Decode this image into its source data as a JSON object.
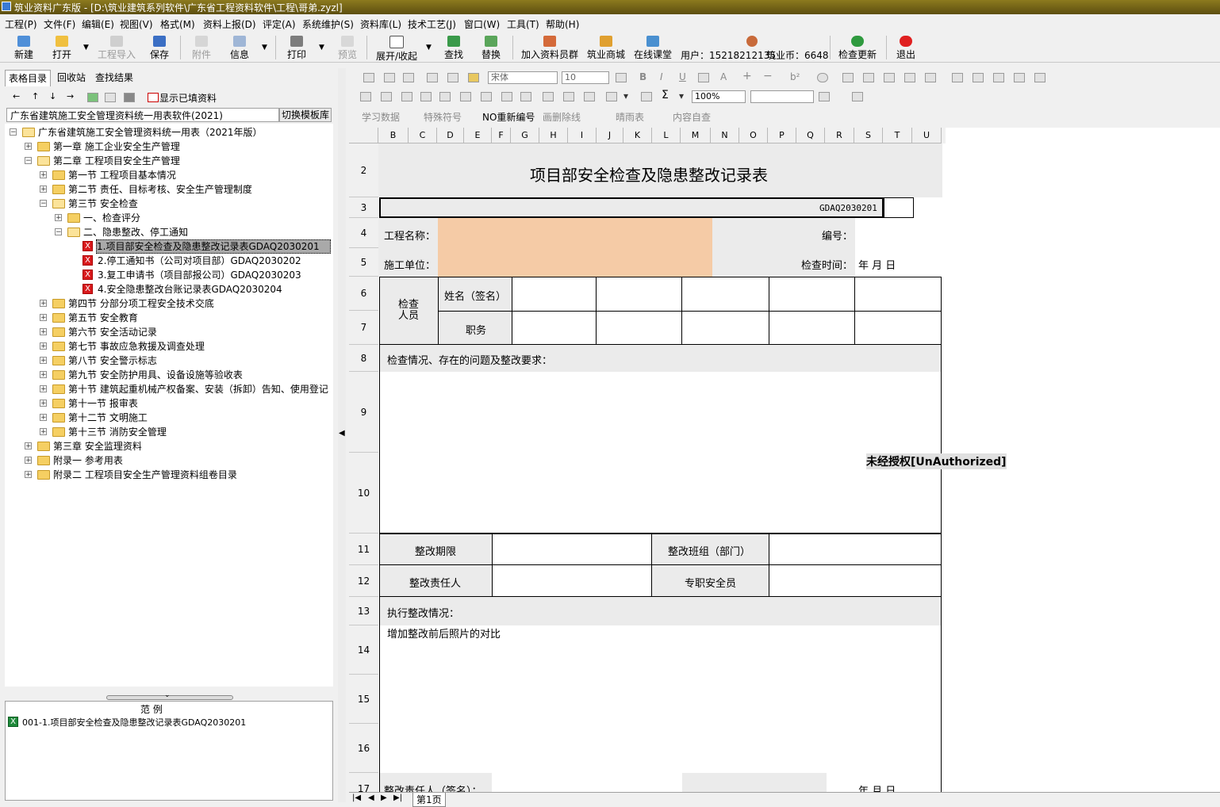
{
  "window": {
    "title": "筑业资料广东版 - [D:\\筑业建筑系列软件\\广东省工程资料软件\\工程\\哥弟.zyzl]"
  },
  "menu": [
    "工程(P)",
    "文件(F)",
    "编辑(E)",
    "视图(V)",
    "格式(M)",
    "资料上报(D)",
    "评定(A)",
    "系统维护(S)",
    "资料库(L)",
    "技术工艺(J)",
    "窗口(W)",
    "工具(T)",
    "帮助(H)"
  ],
  "toolbar": {
    "new": "新建",
    "open": "打开",
    "import": "工程导入",
    "save": "保存",
    "attach": "附件",
    "info": "信息",
    "print": "打印",
    "preview": "预览",
    "expand": "展开/收起",
    "find": "查找",
    "replace": "替换",
    "join": "加入资料员群",
    "shop": "筑业商城",
    "course": "在线课堂",
    "user": "用户：15218212135",
    "coins": "筑业币：6648",
    "update": "检查更新",
    "exit": "退出"
  },
  "left": {
    "tabs": [
      "表格目录",
      "回收站",
      "查找结果"
    ],
    "show_filled": "显示已填资料",
    "combo": "广东省建筑施工安全管理资料统一用表软件(2021)",
    "switch": "切换模板库",
    "tree": [
      "广东省建筑施工安全管理资料统一用表（2021年版）",
      "第一章 施工企业安全生产管理",
      "第二章 工程项目安全生产管理",
      "第一节 工程项目基本情况",
      "第二节 责任、目标考核、安全生产管理制度",
      "第三节 安全检查",
      "一、检查评分",
      "二、隐患整改、停工通知",
      "1.项目部安全检查及隐患整改记录表GDAQ2030201",
      "2.停工通知书（公司对项目部）GDAQ2030202",
      "3.复工申请书（项目部报公司）GDAQ2030203",
      "4.安全隐患整改台账记录表GDAQ2030204",
      "第四节 分部分项工程安全技术交底",
      "第五节 安全教育",
      "第六节 安全活动记录",
      "第七节 事故应急救援及调查处理",
      "第八节 安全警示标志",
      "第九节 安全防护用具、设备设施等验收表",
      "第十节 建筑起重机械产权备案、安装（拆卸）告知、使用登记",
      "第十一节 报审表",
      "第十二节 文明施工",
      "第十三节 消防安全管理",
      "第三章 安全监理资料",
      "附录一 参考用表",
      "附录二 工程项目安全生产管理资料组卷目录"
    ],
    "example_header": "范        例",
    "example_item": "001-1.项目部安全检查及隐患整改记录表GDAQ2030201"
  },
  "format": {
    "font": "宋体",
    "size": "10",
    "zoom": "100%",
    "study": "学习数据",
    "special": "特殊符号",
    "renumber": "重新编号",
    "strike": "画删除线",
    "weather": "晴雨表",
    "check": "内容自查"
  },
  "sheet": {
    "columns": [
      "B",
      "C",
      "D",
      "E",
      "F",
      "G",
      "H",
      "I",
      "J",
      "K",
      "L",
      "M",
      "N",
      "O",
      "P",
      "Q",
      "R",
      "S",
      "T",
      "U"
    ],
    "rows": [
      "2",
      "3",
      "4",
      "5",
      "6",
      "7",
      "8",
      "9",
      "10",
      "11",
      "12",
      "13",
      "14",
      "15",
      "16",
      "17"
    ],
    "title": "项目部安全检查及隐患整改记录表",
    "code": "GDAQ2030201",
    "project_name": "工程名称：",
    "number": "编号：",
    "builder": "施工单位：",
    "check_time": "检查时间：",
    "ymd": "年   月   日",
    "inspectors": "检查人员",
    "name_sign": "姓名（签名）",
    "position": "职务",
    "situation": "检查情况、存在的问题及整改要求：",
    "deadline": "整改期限",
    "team": "整改班组（部门）",
    "responsible": "整改责任人",
    "safety_officer": "专职安全员",
    "execution": "执行整改情况：",
    "photo_note": "增加整改前后照片的对比",
    "resp_sign": "整改责任人（签名）：",
    "ymd2": "年   月   日"
  },
  "watermark": "未经授权[UnAuthorized]",
  "sheet_tab": "第1页"
}
